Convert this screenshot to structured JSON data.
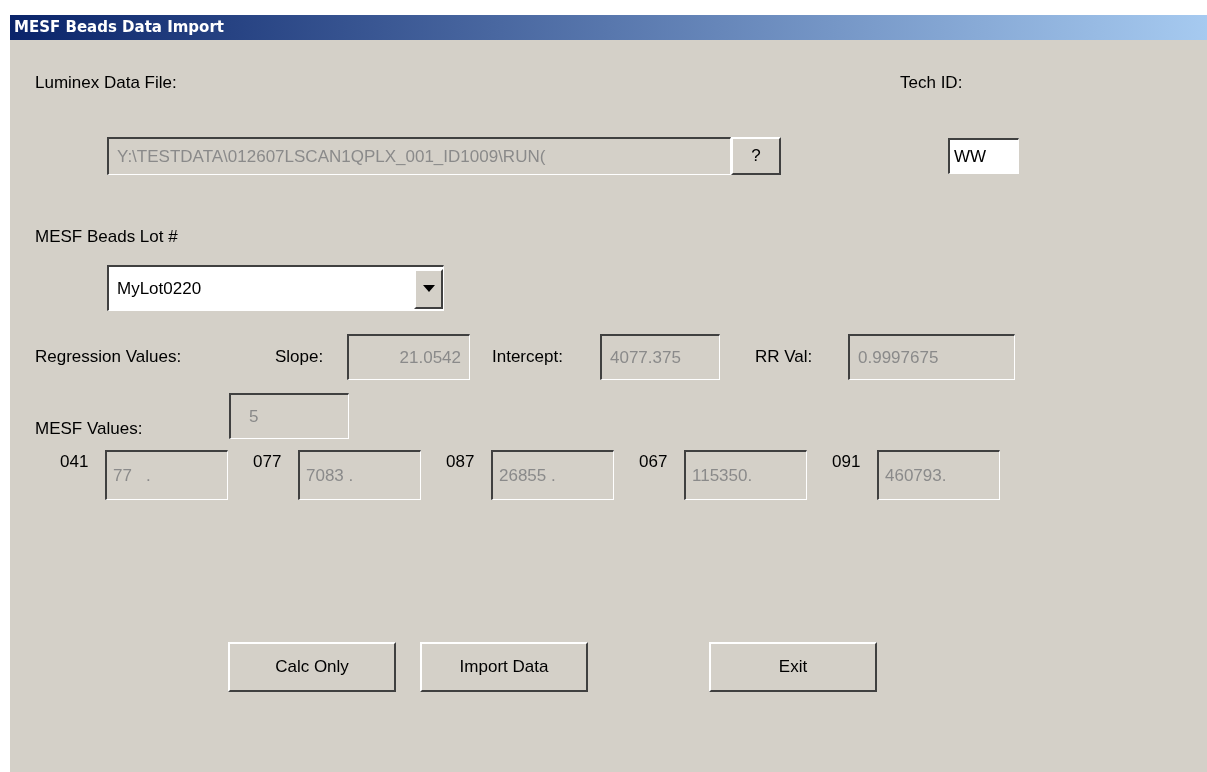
{
  "window": {
    "title": "MESF Beads Data Import"
  },
  "data_file": {
    "label": "Luminex Data File:",
    "value": "Y:\\TESTDATA\\012607LSCAN1QPLX_001_ID1009\\RUN(",
    "disabled": true,
    "browse_button": "?"
  },
  "tech_id": {
    "label": "Tech ID:",
    "value": "WW"
  },
  "lot": {
    "label": "MESF Beads  Lot #",
    "value": "MyLot0220"
  },
  "regression": {
    "label": "Regression Values:",
    "fields": [
      {
        "label": "Slope:",
        "value": "21.0542",
        "disabled": true
      },
      {
        "label": "Intercept:",
        "value": "4077.375",
        "disabled": true
      },
      {
        "label": "RR Val:",
        "value": "0.9997675",
        "disabled": true
      }
    ]
  },
  "mesf": {
    "label": "MESF Values:",
    "count": "5",
    "disabled": true,
    "values": [
      {
        "label": "041",
        "value": "77   .",
        "disabled": true
      },
      {
        "label": "077",
        "value": "7083 .",
        "disabled": true
      },
      {
        "label": "087",
        "value": "26855 .",
        "disabled": true
      },
      {
        "label": "067",
        "value": "115350.",
        "disabled": true
      },
      {
        "label": "091",
        "value": "460793.",
        "disabled": true
      }
    ]
  },
  "buttons": [
    {
      "label": "Calc Only"
    },
    {
      "label": "Import Data"
    },
    {
      "label": "Exit"
    }
  ]
}
